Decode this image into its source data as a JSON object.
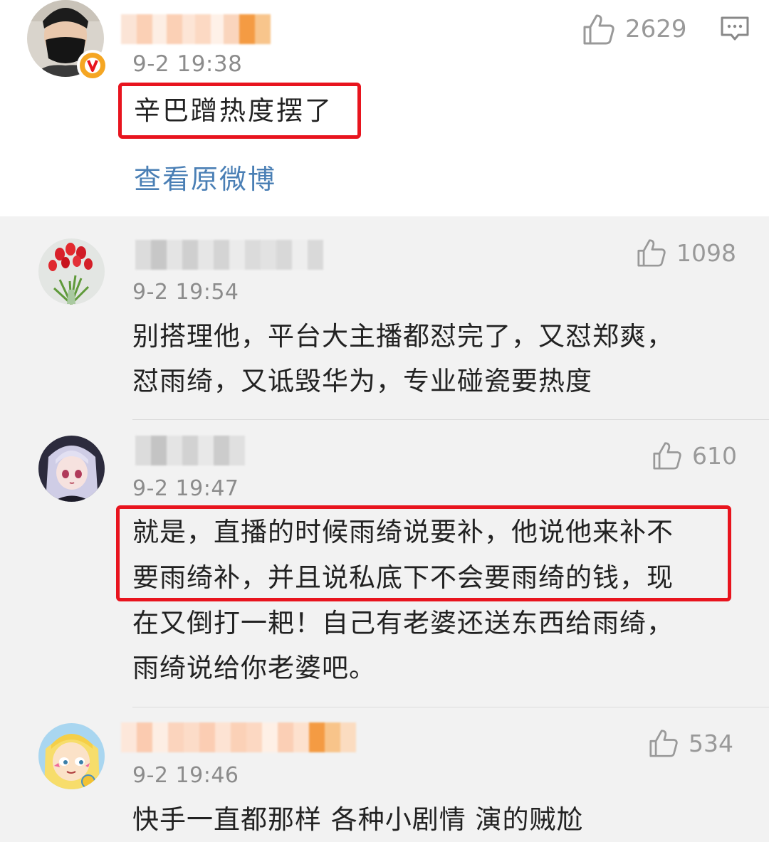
{
  "main_comment": {
    "time": "9-2 19:38",
    "text": "辛巴蹭热度摆了",
    "likes": "2629",
    "view_original": "查看原微博"
  },
  "replies": [
    {
      "time": "9-2 19:54",
      "likes": "1098",
      "lines": [
        "别搭理他，平台大主播都怼完了，又怼郑爽，",
        "怼雨绮，又诋毁华为，专业碰瓷要热度"
      ]
    },
    {
      "time": "9-2 19:47",
      "likes": "610",
      "lines": [
        "就是，直播的时候雨绮说要补，他说他来补不",
        "要雨绮补，并且说私底下不会要雨绮的钱，现",
        "在又倒打一耙！自己有老婆还送东西给雨绮，",
        "雨绮说给你老婆吧。"
      ]
    },
    {
      "time": "9-2 19:46",
      "likes": "534",
      "lines": [
        "快手一直都那样 各种小剧情 演的贼尬"
      ]
    }
  ],
  "icons": {
    "like": "thumbs-up-icon",
    "reply": "comment-bubble-icon",
    "verified": "verified-v-badge-icon"
  },
  "colors": {
    "highlight_box": "#e8141e",
    "link": "#4a7fb5",
    "meta_text": "#8c8c8c",
    "verified_badge": "#f5a623"
  }
}
